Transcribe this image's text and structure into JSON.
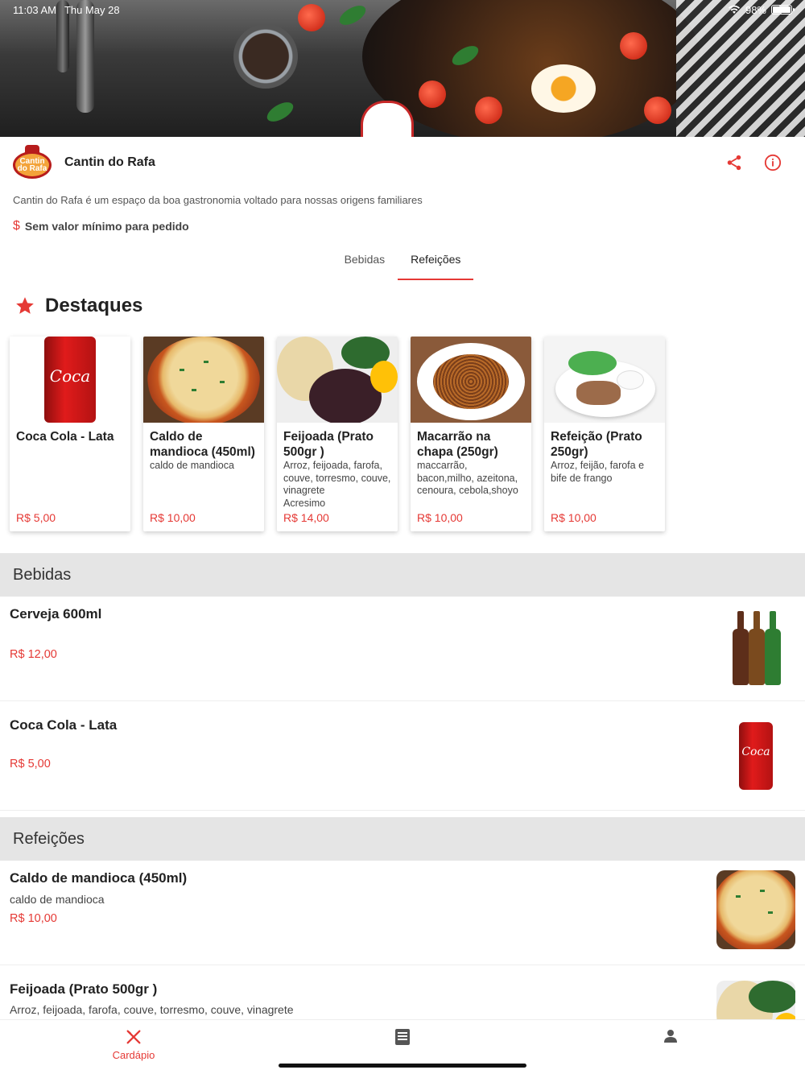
{
  "status_bar": {
    "time": "11:03 AM",
    "date": "Thu May 28",
    "battery": "98%",
    "battery_level": 0.98
  },
  "header": {
    "logo_text": "Cantin do Rafa",
    "restaurant_name": "Cantin do Rafa",
    "icons": [
      "share-icon",
      "info-icon"
    ]
  },
  "description": "Cantin do Rafa é um espaço da boa gastronomia voltado para nossas origens familiares",
  "minimum_order": {
    "icon": "$",
    "text": "Sem valor mínimo para pedido"
  },
  "tabs": [
    {
      "label": "Bebidas",
      "active": false
    },
    {
      "label": "Refeições",
      "active": true
    }
  ],
  "highlights": {
    "title": "Destaques",
    "items": [
      {
        "name": "Coca Cola - Lata",
        "description": "",
        "price": "R$ 5,00"
      },
      {
        "name": "Caldo de mandioca (450ml)",
        "description": "caldo de mandioca",
        "price": "R$ 10,00"
      },
      {
        "name": "Feijoada (Prato 500gr )",
        "description": "Arroz, feijoada, farofa, couve, torresmo, couve, vinagrete\n Acresimo",
        "price": "R$ 14,00"
      },
      {
        "name": "Macarrão na chapa (250gr)",
        "description": "maccarrão, bacon,milho, azeitona, cenoura, cebola,shoyo",
        "price": "R$ 10,00"
      },
      {
        "name": "Refeição (Prato 250gr)",
        "description": "Arroz, feijão, farofa e bife de frango",
        "price": "R$ 10,00"
      }
    ]
  },
  "sections": [
    {
      "title": "Bebidas",
      "items": [
        {
          "name": "Cerveja 600ml",
          "description": "",
          "price": "R$ 12,00"
        },
        {
          "name": "Coca Cola - Lata",
          "description": "",
          "price": "R$ 5,00"
        }
      ]
    },
    {
      "title": "Refeições",
      "items": [
        {
          "name": "Caldo de mandioca (450ml)",
          "description": "caldo de mandioca",
          "price": "R$ 10,00"
        },
        {
          "name": "Feijoada (Prato 500gr )",
          "description": "Arroz, feijoada, farofa, couve, torresmo, couve, vinagrete",
          "price": ""
        }
      ]
    }
  ],
  "bottom_nav": [
    {
      "label": "Cardápio",
      "icon": "utensils-icon",
      "active": true
    },
    {
      "label": "",
      "icon": "receipt-icon",
      "active": false
    },
    {
      "label": "",
      "icon": "person-icon",
      "active": false
    }
  ],
  "colors": {
    "accent": "#e53935",
    "section_bg": "#e5e5e5"
  }
}
